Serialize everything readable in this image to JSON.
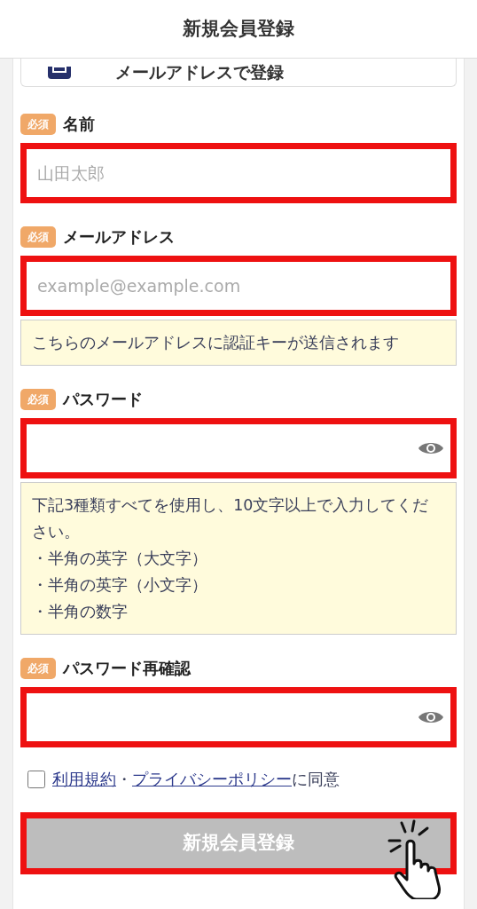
{
  "header": {
    "title": "新規会員登録"
  },
  "email_signup_button": {
    "label": "メールアドレスで登録"
  },
  "fields": [
    {
      "kind": "text",
      "required_badge": "必須",
      "label": "名前",
      "placeholder": "山田太郎",
      "highlighted": true
    },
    {
      "kind": "email",
      "required_badge": "必須",
      "label": "メールアドレス",
      "placeholder": "example@example.com",
      "highlighted": true,
      "note": [
        "こちらのメールアドレスに認証キーが送信されます"
      ]
    },
    {
      "kind": "password",
      "required_badge": "必須",
      "label": "パスワード",
      "highlighted": true,
      "note": [
        "下記3種類すべてを使用し、10文字以上で入力してください。",
        "・半角の英字（大文字）",
        "・半角の英字（小文字）",
        "・半角の数字"
      ]
    },
    {
      "kind": "password",
      "required_badge": "必須",
      "label": "パスワード再確認",
      "highlighted": true
    }
  ],
  "agreement": {
    "checked": false,
    "links": [
      "利用規約",
      "プライバシーポリシー"
    ],
    "separator": "・",
    "suffix": "に同意"
  },
  "submit_button": {
    "label": "新規会員登録",
    "disabled": true,
    "highlighted": true
  }
}
